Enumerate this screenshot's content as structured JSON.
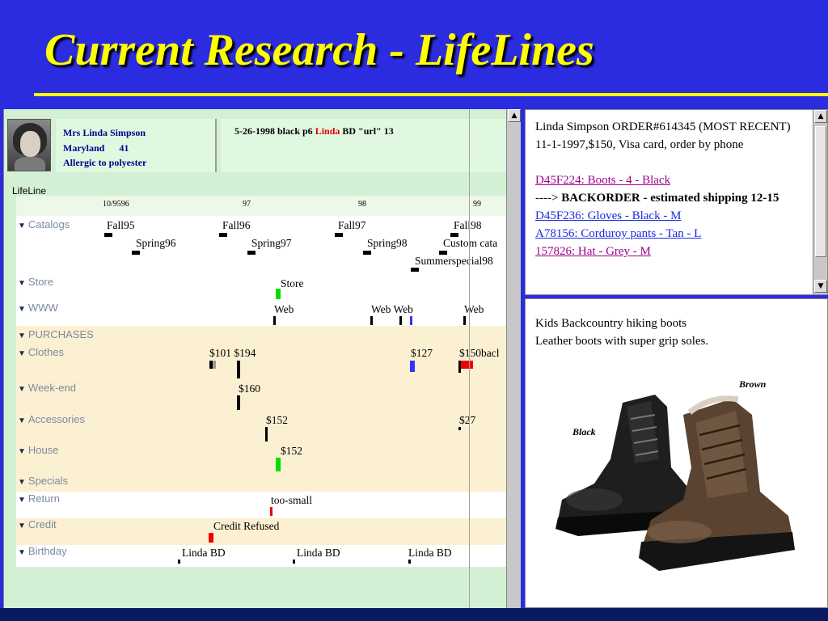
{
  "slide": {
    "title": "Current Research - LifeLines"
  },
  "patient": {
    "name": "Mrs Linda Simpson",
    "state": "Maryland",
    "age": "41",
    "allergy": "Allergic to polyester"
  },
  "record": {
    "prefix": "5-26-1998 black p6 ",
    "highlight": "Linda",
    "suffix": " BD \"url\" 13"
  },
  "lifeline": {
    "label": "LifeLine",
    "ticks": [
      "10/9596",
      "97",
      "98",
      "99"
    ],
    "facets": {
      "catalogs": "Catalogs",
      "store": "Store",
      "www": "WWW",
      "purchases": "PURCHASES",
      "clothes": "Clothes",
      "weekend": "Week-end",
      "accessories": "Accessories",
      "house": "House",
      "specials": "Specials",
      "return": "Return",
      "credit": "Credit",
      "birthday": "Birthday"
    },
    "events": {
      "fall95": "Fall95",
      "fall96": "Fall96",
      "fall97": "Fall97",
      "fall98": "Fall98",
      "spring96": "Spring96",
      "spring97": "Spring97",
      "spring98": "Spring98",
      "custom": "Custom cata",
      "summer98": "Summerspecial98",
      "store1": "Store",
      "web1": "Web",
      "web2": "Web Web",
      "web3": "Web",
      "clothes1": "$101 $194",
      "clothes2": "$127",
      "clothes3": "$150bacl",
      "weekend1": "$160",
      "acc1": "$152",
      "acc2": "$27",
      "house1": "$152",
      "return1": "too-small",
      "credit1": "Credit Refused",
      "bd1": "Linda BD",
      "bd2": "Linda BD",
      "bd3": "Linda BD"
    },
    "colors": {
      "black": "#000000",
      "green": "#00dd00",
      "blue": "#3333ff",
      "red": "#ee0000",
      "grey": "#9a9a9a"
    }
  },
  "order_panel": {
    "header": "Linda Simpson ORDER#614345 (MOST RECENT)",
    "line2": "11-1-1997,$150, Visa card, order by phone",
    "item1": "D45F224: Boots - 4 - Black ",
    "backorder_prefix": "---->",
    "backorder_text": " BACKORDER - estimated shipping 12-15",
    "item2": "D45F236: Gloves - Black - M",
    "item3": "A78156: Corduroy pants - Tan - L",
    "item4": "157826: Hat - Grey - M"
  },
  "product_panel": {
    "line1": "Kids Backcountry hiking boots",
    "line2": "Leather boots with super grip soles.",
    "label_brown": "Brown",
    "label_black": "Black"
  },
  "scroll": {
    "up": "▲",
    "down": "▼"
  }
}
